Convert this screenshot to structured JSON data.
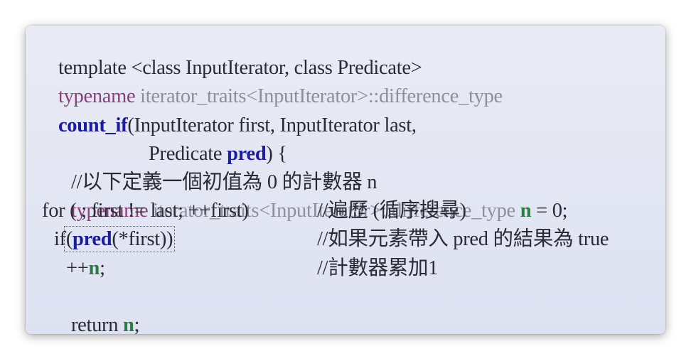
{
  "code": {
    "line1": "template <class InputIterator, class Predicate>",
    "line2": {
      "kw": "typename",
      "rest": " iterator_traits<InputIterator>::difference_type"
    },
    "line3": {
      "fn": "count_if",
      "rest": "(InputIterator first, InputIterator last,"
    },
    "line4": {
      "pre": "Predicate ",
      "pred": "pred",
      "post": ") {"
    },
    "line5": "//以下定義一個初值為 0 的計數器 n",
    "line6": {
      "kw": "typename",
      "rest": " iterator_traits<InputIterator>::difference_type ",
      "n": "n",
      "post": " = 0;"
    },
    "line7": {
      "code": "for ( ; first != last; ++first)",
      "comment": "//遍歷 (循序搜尋)"
    },
    "line8": {
      "if": "if",
      "open": "(",
      "pred": "pred",
      "args": "(*first))",
      "comment": "//如果元素帶入 pred 的結果為 true"
    },
    "line9": {
      "inc": "++",
      "n": "n",
      "semi": ";",
      "comment": "//計數器累加1"
    },
    "line10": {
      "ret": "return ",
      "n": "n",
      "semi": ";"
    },
    "line11": "}"
  }
}
